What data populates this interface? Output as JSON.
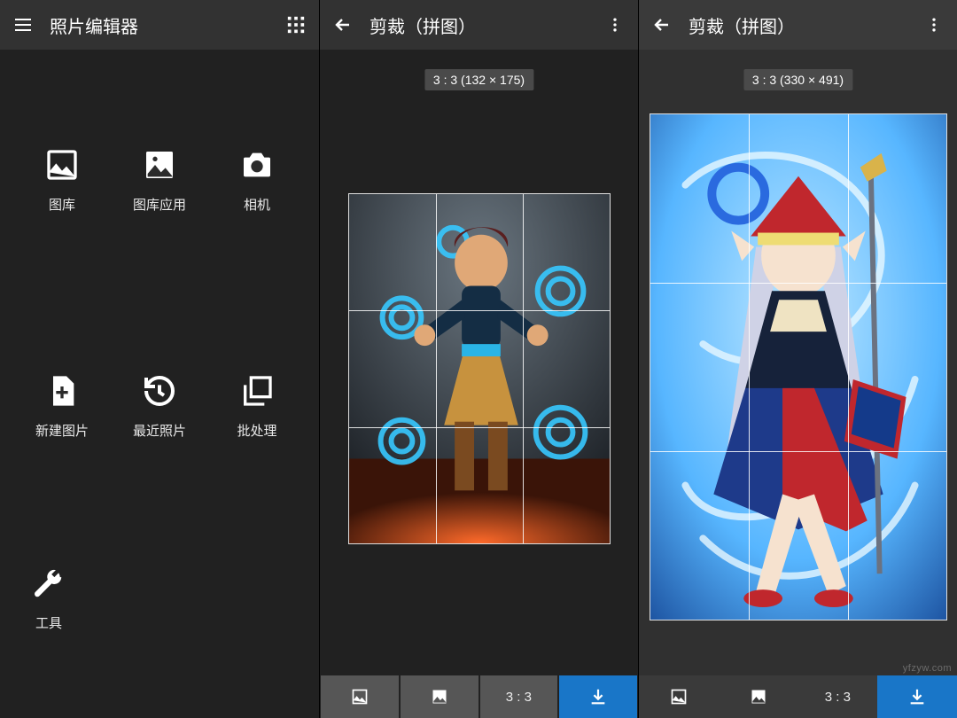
{
  "left": {
    "title": "照片编辑器",
    "actions": [
      {
        "id": "gallery",
        "label": "图库"
      },
      {
        "id": "gallery-app",
        "label": "图库应用"
      },
      {
        "id": "camera",
        "label": "相机"
      },
      {
        "id": "new-image",
        "label": "新建图片"
      },
      {
        "id": "recent",
        "label": "最近照片"
      },
      {
        "id": "batch",
        "label": "批处理"
      }
    ],
    "tools_label": "工具"
  },
  "mid": {
    "title": "剪裁（拼图）",
    "ratio_badge": "3 : 3 (132 × 175)",
    "bottom_ratio": "3 : 3"
  },
  "right": {
    "title": "剪裁（拼图）",
    "ratio_badge": "3 : 3 (330 × 491)",
    "bottom_ratio": "3 : 3"
  },
  "watermark": "yfzyw.com",
  "colors": {
    "topbar": "#323232",
    "panel_dark": "#212121",
    "panel_light": "#303030",
    "accent": "#1976c8"
  }
}
